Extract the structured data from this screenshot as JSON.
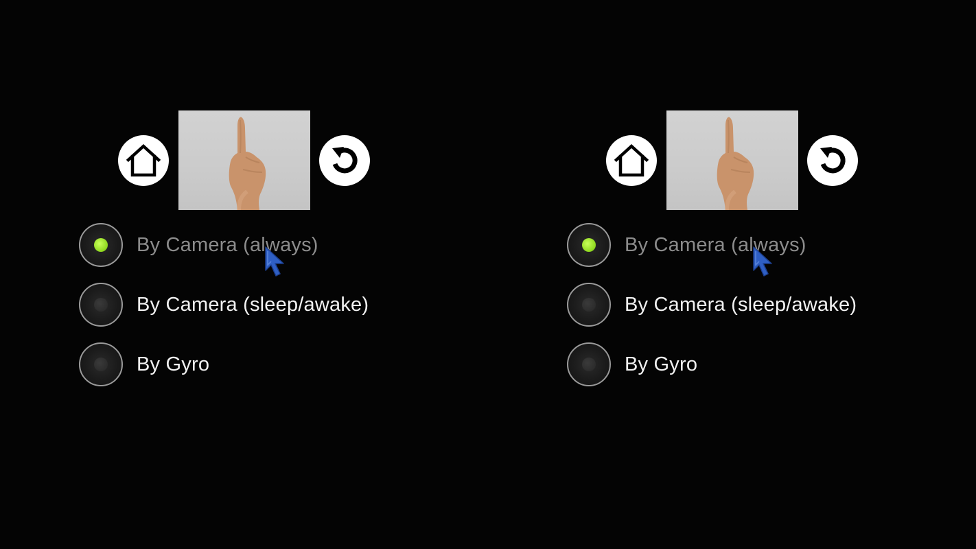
{
  "eyes": [
    {
      "id": "left",
      "options": [
        {
          "label": "By Camera (always)",
          "checked": true
        },
        {
          "label": "By Camera (sleep/awake)",
          "checked": false
        },
        {
          "label": "By Gyro",
          "checked": false
        }
      ]
    },
    {
      "id": "right",
      "options": [
        {
          "label": "By Camera (always)",
          "checked": true
        },
        {
          "label": "By Camera (sleep/awake)",
          "checked": false
        },
        {
          "label": "By Gyro",
          "checked": false
        }
      ]
    }
  ],
  "icons": {
    "home": "home-icon",
    "replay": "replay-icon",
    "preview": "hand-pointing-up-image",
    "cursor": "mouse-pointer-icon"
  },
  "colors": {
    "background": "#040404",
    "radio_selected": "#8ed81e",
    "label_active": "#f2f2f2",
    "label_selected_dim": "#8c8c8c",
    "cursor": "#2f5fc4"
  }
}
